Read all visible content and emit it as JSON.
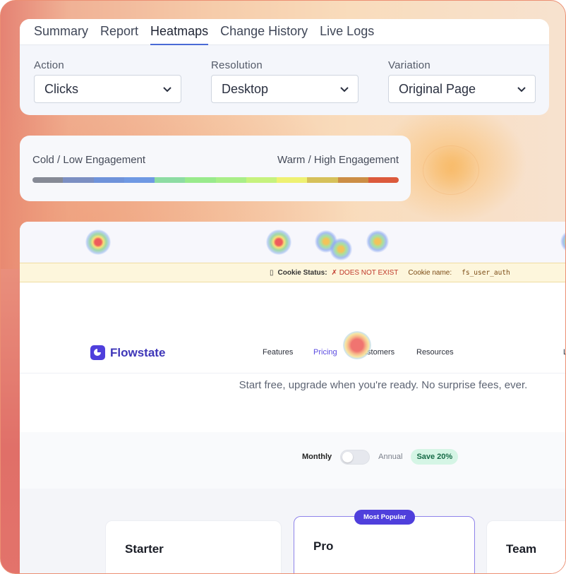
{
  "tabs": [
    {
      "label": "Summary"
    },
    {
      "label": "Report"
    },
    {
      "label": "Heatmaps"
    },
    {
      "label": "Change History"
    },
    {
      "label": "Live Logs"
    }
  ],
  "active_tab": "Heatmaps",
  "filters": {
    "action": {
      "label": "Action",
      "value": "Clicks"
    },
    "resolution": {
      "label": "Resolution",
      "value": "Desktop"
    },
    "variation": {
      "label": "Variation",
      "value": "Original Page"
    }
  },
  "legend": {
    "low_label": "Cold / Low Engagement",
    "high_label": "Warm / High Engagement",
    "colors": [
      "#868a95",
      "#7c8fc2",
      "#6f93da",
      "#6f99e3",
      "#8ddca3",
      "#99ea8c",
      "#a9ee88",
      "#c6f27e",
      "#eef172",
      "#d6c15a",
      "#cc8e45",
      "#dc5a3c"
    ]
  },
  "preview": {
    "cookie": {
      "icon": "▯",
      "status_label": "Cookie Status:",
      "status_value": "✗ DOES NOT EXIST",
      "name_label": "Cookie name:",
      "name_value": "fs_user_auth"
    },
    "logo": "Flowstate",
    "nav": [
      "Features",
      "Pricing",
      "Customers",
      "Resources",
      "L"
    ],
    "nav_active": "Pricing",
    "subtitle": "Start free, upgrade when you're ready. No surprise fees, ever.",
    "billing": {
      "monthly": "Monthly",
      "annual": "Annual",
      "save": "Save 20%"
    },
    "plans": [
      {
        "name": "Starter"
      },
      {
        "name": "Pro",
        "badge": "Most Popular"
      },
      {
        "name": "Team"
      }
    ]
  },
  "colors": {
    "accent": "#4f3fdc",
    "tab_underline": "#4a6bd6",
    "cookie_bg": "#fdf6dc",
    "save_bg": "#d5f5e5"
  }
}
